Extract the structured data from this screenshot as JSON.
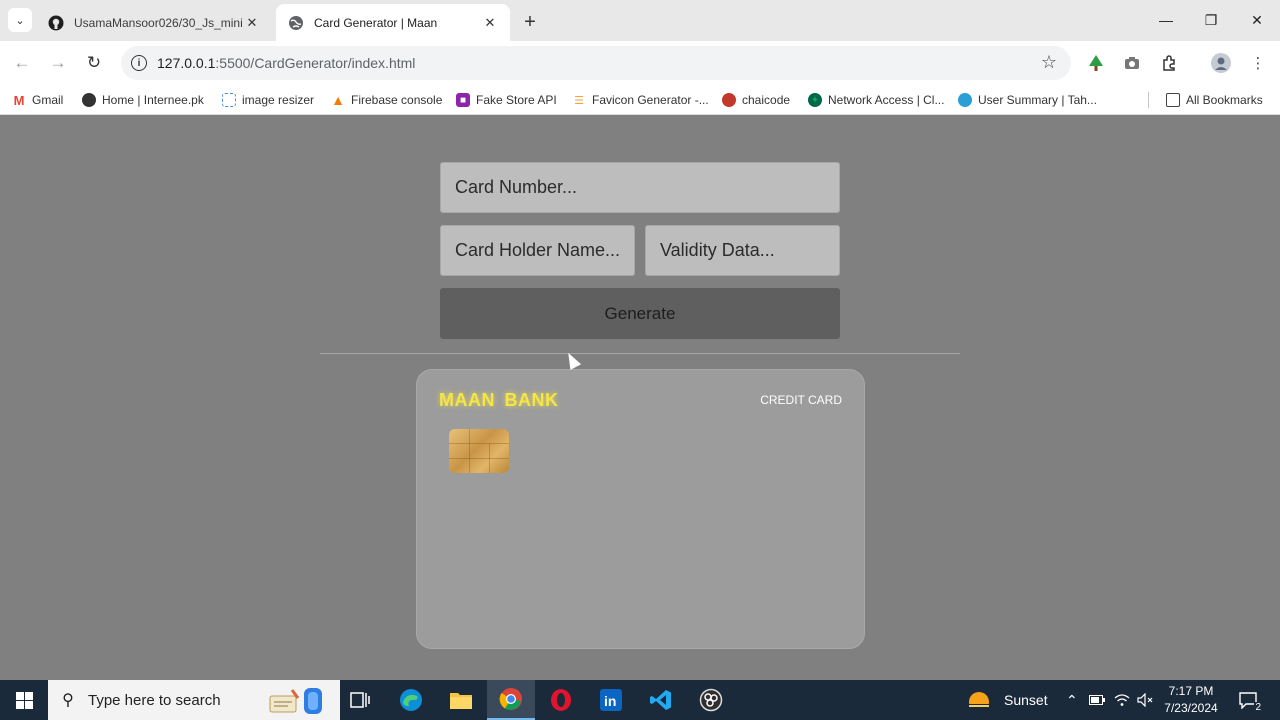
{
  "browser": {
    "tabs": [
      {
        "title": "UsamaMansoor026/30_Js_mini",
        "active": false
      },
      {
        "title": "Card Generator | Maan",
        "active": true
      }
    ],
    "url_host": "127.0.0.1",
    "url_path": ":5500/CardGenerator/index.html",
    "bookmarks": [
      {
        "label": "Gmail",
        "icon": "gmail-icon",
        "color": "#ea4335"
      },
      {
        "label": "Home | Internee.pk",
        "icon": "globe-icon",
        "color": "#333333"
      },
      {
        "label": "image resizer",
        "icon": "image-resizer-icon",
        "color": "#4a90d9"
      },
      {
        "label": "Firebase console",
        "icon": "firebase-icon",
        "color": "#f57c00"
      },
      {
        "label": "Fake Store API",
        "icon": "fakestore-icon",
        "color": "#8e24aa"
      },
      {
        "label": "Favicon Generator -...",
        "icon": "favicon-icon",
        "color": "#ff9f43"
      },
      {
        "label": "chaicode",
        "icon": "chaicode-icon",
        "color": "#c0392b"
      },
      {
        "label": "Network Access | Cl...",
        "icon": "mongodb-icon",
        "color": "#00684a"
      },
      {
        "label": "User Summary | Tah...",
        "icon": "user-summary-icon",
        "color": "#2a9fd6"
      }
    ],
    "all_bookmarks": "All Bookmarks"
  },
  "form": {
    "card_number_placeholder": "Card Number...",
    "holder_placeholder": "Card Holder Name...",
    "validity_placeholder": "Validity Data...",
    "generate_label": "Generate"
  },
  "card": {
    "bank_name": "MAAN BANK",
    "card_type": "CREDIT CARD",
    "bank_color": "#f5e642"
  },
  "taskbar": {
    "search_placeholder": "Type here to search",
    "weather": "Sunset",
    "time": "7:17 PM",
    "date": "7/23/2024",
    "notifications": "2"
  }
}
